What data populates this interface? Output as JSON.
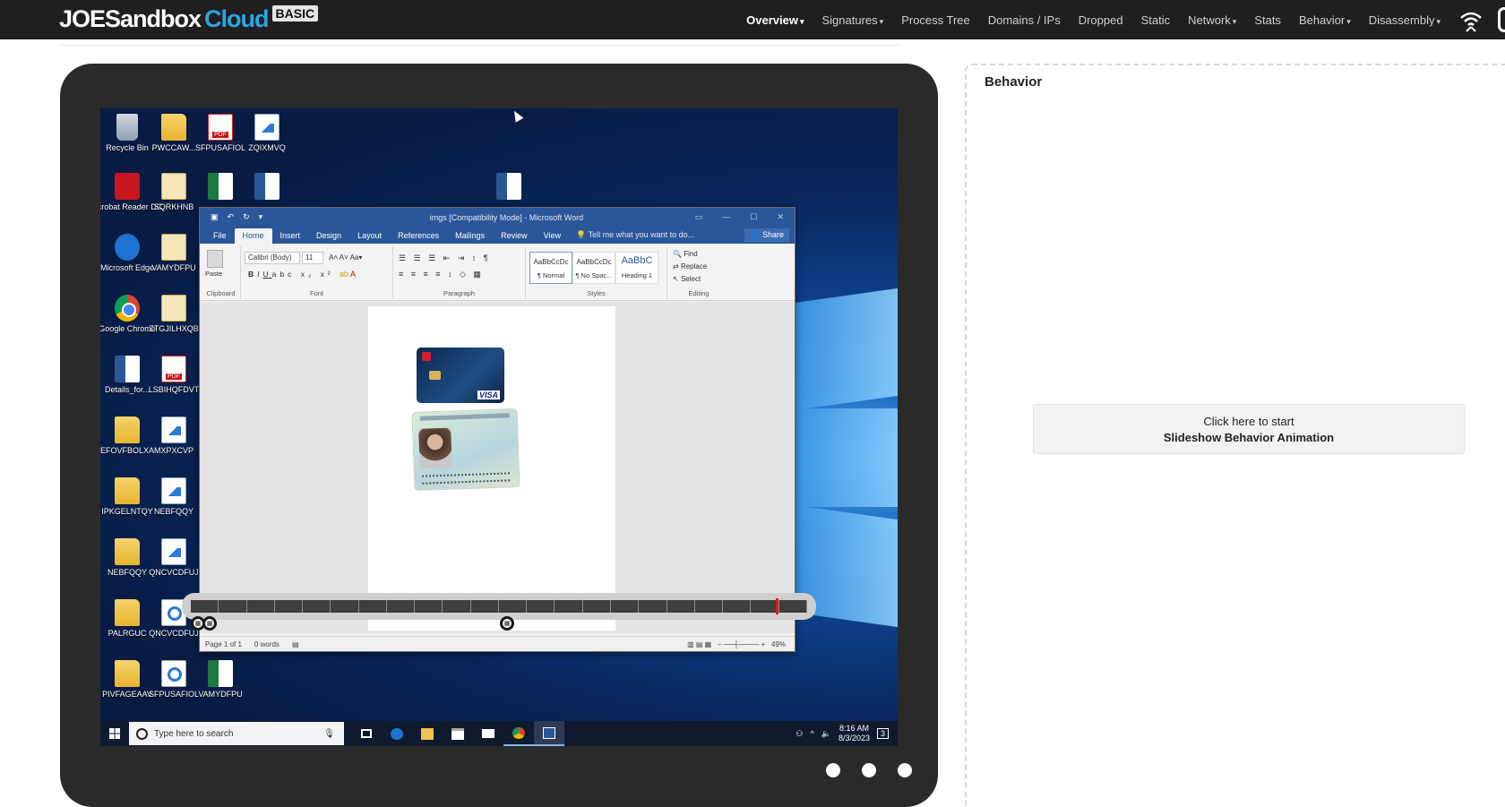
{
  "brand": {
    "name_a": "JOESandbox",
    "name_b": "Cloud",
    "tier": "BASIC"
  },
  "nav": {
    "items": [
      {
        "label": "Overview",
        "caret": "▾",
        "active": true
      },
      {
        "label": "Signatures",
        "caret": "▾"
      },
      {
        "label": "Process Tree",
        "caret": ""
      },
      {
        "label": "Domains / IPs",
        "caret": ""
      },
      {
        "label": "Dropped",
        "caret": ""
      },
      {
        "label": "Static",
        "caret": ""
      },
      {
        "label": "Network",
        "caret": "▾"
      },
      {
        "label": "Stats",
        "caret": ""
      },
      {
        "label": "Behavior",
        "caret": "▾"
      },
      {
        "label": "Disassembly",
        "caret": "▾"
      }
    ],
    "icon": "wifi-icon"
  },
  "desktop": {
    "icons": [
      {
        "label": "Recycle Bin",
        "type": "bin"
      },
      {
        "label": "PWCCAW...",
        "type": "folder"
      },
      {
        "label": "SFPUSAFIOL",
        "type": "pdf"
      },
      {
        "label": "ZQIXMVQ",
        "type": "img"
      },
      {
        "label": "Acrobat Reader DC",
        "type": "acrobat"
      },
      {
        "label": "SQRKHNB",
        "type": "cfg"
      },
      {
        "label": "",
        "type": "excel"
      },
      {
        "label": "",
        "type": "word"
      },
      {
        "label": "",
        "type": "word"
      },
      {
        "label": "Microsoft Edge",
        "type": "edge"
      },
      {
        "label": "VAMYDFPU",
        "type": "cfg"
      },
      {
        "label": "Google Chrome",
        "type": "chrome"
      },
      {
        "label": "ZTGJILHXQB",
        "type": "cfg"
      },
      {
        "label": "Details_for...",
        "type": "word"
      },
      {
        "label": "LSBIHQFDVT",
        "type": "pdf"
      },
      {
        "label": "EFOVFBOLXA",
        "type": "folder"
      },
      {
        "label": "MXPXCVP",
        "type": "img"
      },
      {
        "label": "IPKGELNTQY",
        "type": "folder"
      },
      {
        "label": "NEBFQQY",
        "type": "img"
      },
      {
        "label": "NEBFQQY",
        "type": "folder"
      },
      {
        "label": "QNCVCDFUJ",
        "type": "img"
      },
      {
        "label": "PALRGUC",
        "type": "folder"
      },
      {
        "label": "QNCVCDFUJ",
        "type": "target"
      },
      {
        "label": "PIVFAGEAAV",
        "type": "folder"
      },
      {
        "label": "SFPUSAFIOL",
        "type": "target"
      },
      {
        "label": "VAMYDFPU",
        "type": "excel"
      }
    ]
  },
  "word": {
    "title": "imgs [Compatibility Mode] - Microsoft Word",
    "tabs": [
      "File",
      "Home",
      "Insert",
      "Design",
      "Layout",
      "References",
      "Mailings",
      "Review",
      "View"
    ],
    "active_tab": "Home",
    "tell_me": "Tell me what you want to do...",
    "share": "Share",
    "font_name": "Calibri (Body)",
    "font_size": "11",
    "paste": "Paste",
    "groups": [
      "Clipboard",
      "Font",
      "Paragraph",
      "Styles",
      "Editing"
    ],
    "styles": [
      {
        "preview": "AaBbCcDc",
        "name": "¶ Normal"
      },
      {
        "preview": "AaBbCcDc",
        "name": "¶ No Spac..."
      },
      {
        "preview": "AaBbC",
        "name": "Heading 1"
      }
    ],
    "editing": [
      "Find",
      "Replace",
      "Select"
    ],
    "status_page": "Page 1 of 1",
    "status_words": "0 words",
    "zoom": "49%"
  },
  "taskbar": {
    "search_placeholder": "Type here to search",
    "time": "8:16 AM",
    "date": "8/3/2023",
    "notification_count": "3"
  },
  "behavior": {
    "title": "Behavior",
    "slideshow_line1": "Click here to start",
    "slideshow_line2": "Slideshow Behavior Animation"
  },
  "colors": {
    "nav_bg": "#1f1f1f",
    "brand_accent": "#2aa6e0",
    "word_blue": "#2b579a",
    "timeline_marker": "#e01818"
  }
}
